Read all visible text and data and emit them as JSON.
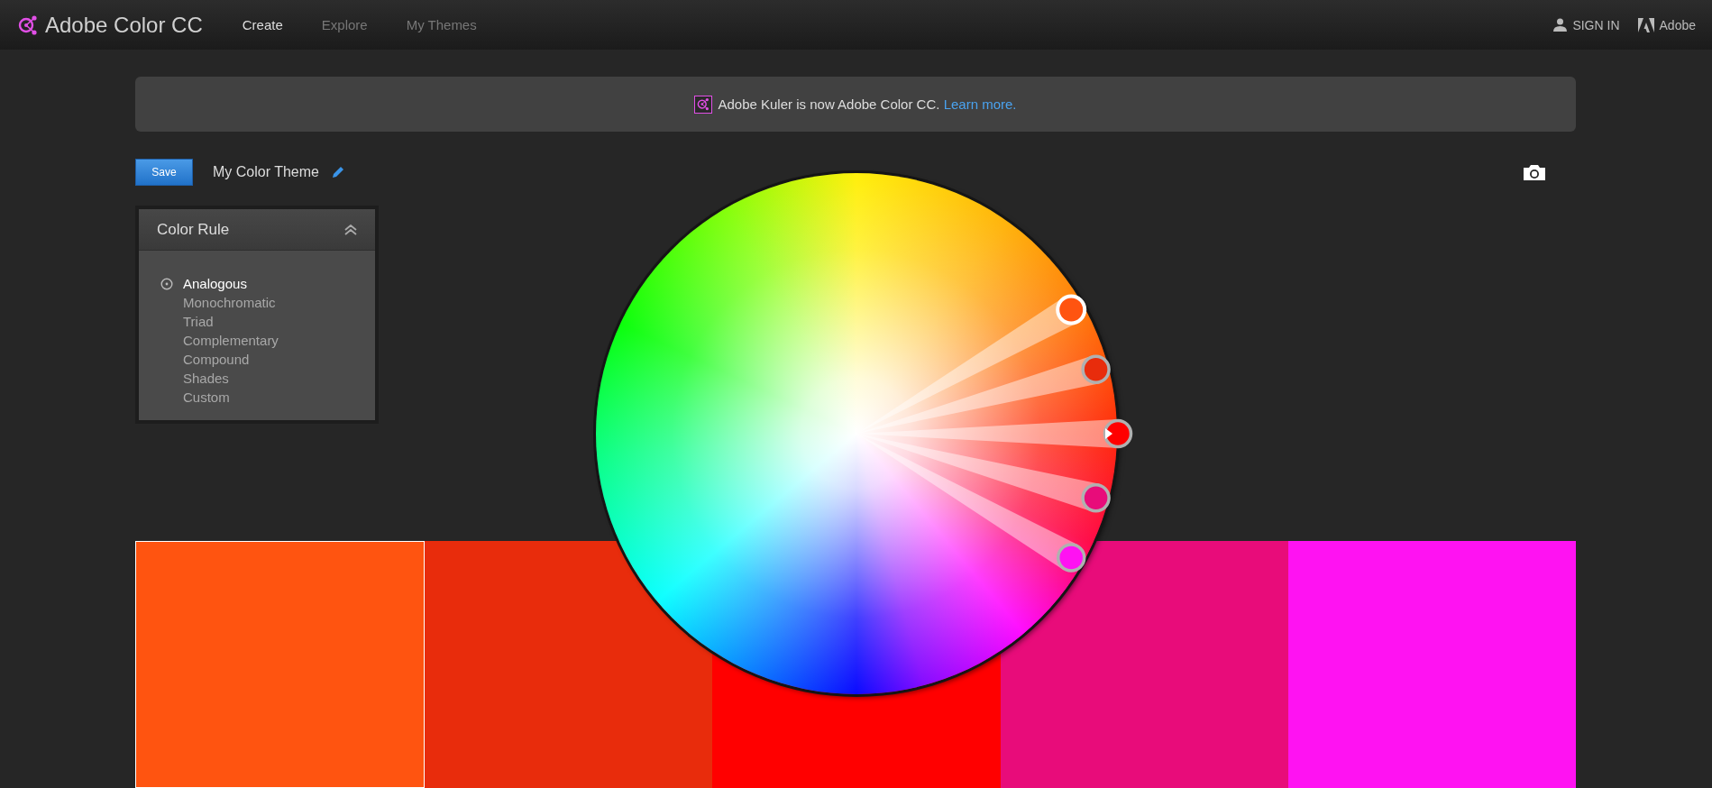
{
  "header": {
    "brand": "Adobe Color CC",
    "nav": [
      {
        "label": "Create",
        "selected": true
      },
      {
        "label": "Explore",
        "selected": false
      },
      {
        "label": "My Themes",
        "selected": false
      }
    ],
    "sign_in": "SIGN IN",
    "adobe": "Adobe"
  },
  "banner": {
    "text": "Adobe Kuler is now Adobe Color CC.",
    "link": "Learn more."
  },
  "toolbar": {
    "save": "Save",
    "theme_name": "My Color Theme"
  },
  "color_rule": {
    "title": "Color Rule",
    "expanded": true,
    "options": [
      {
        "label": "Analogous",
        "selected": true
      },
      {
        "label": "Monochromatic",
        "selected": false
      },
      {
        "label": "Triad",
        "selected": false
      },
      {
        "label": "Complementary",
        "selected": false
      },
      {
        "label": "Compound",
        "selected": false
      },
      {
        "label": "Shades",
        "selected": false
      },
      {
        "label": "Custom",
        "selected": false
      }
    ]
  },
  "wheel": {
    "handles": [
      {
        "color": "#ff5410",
        "selected": true,
        "base": false
      },
      {
        "color": "#e82c0c",
        "selected": false,
        "base": false
      },
      {
        "color": "#ff0000",
        "selected": false,
        "base": true
      },
      {
        "color": "#e80c7a",
        "selected": false,
        "base": false
      },
      {
        "color": "#ff12f2",
        "selected": false,
        "base": false
      }
    ]
  },
  "swatches": [
    {
      "color": "#ff5410",
      "selected": true
    },
    {
      "color": "#e82c0c",
      "selected": false
    },
    {
      "color": "#ff0000",
      "selected": false
    },
    {
      "color": "#e80c7a",
      "selected": false
    },
    {
      "color": "#ff12f2",
      "selected": false
    }
  ]
}
